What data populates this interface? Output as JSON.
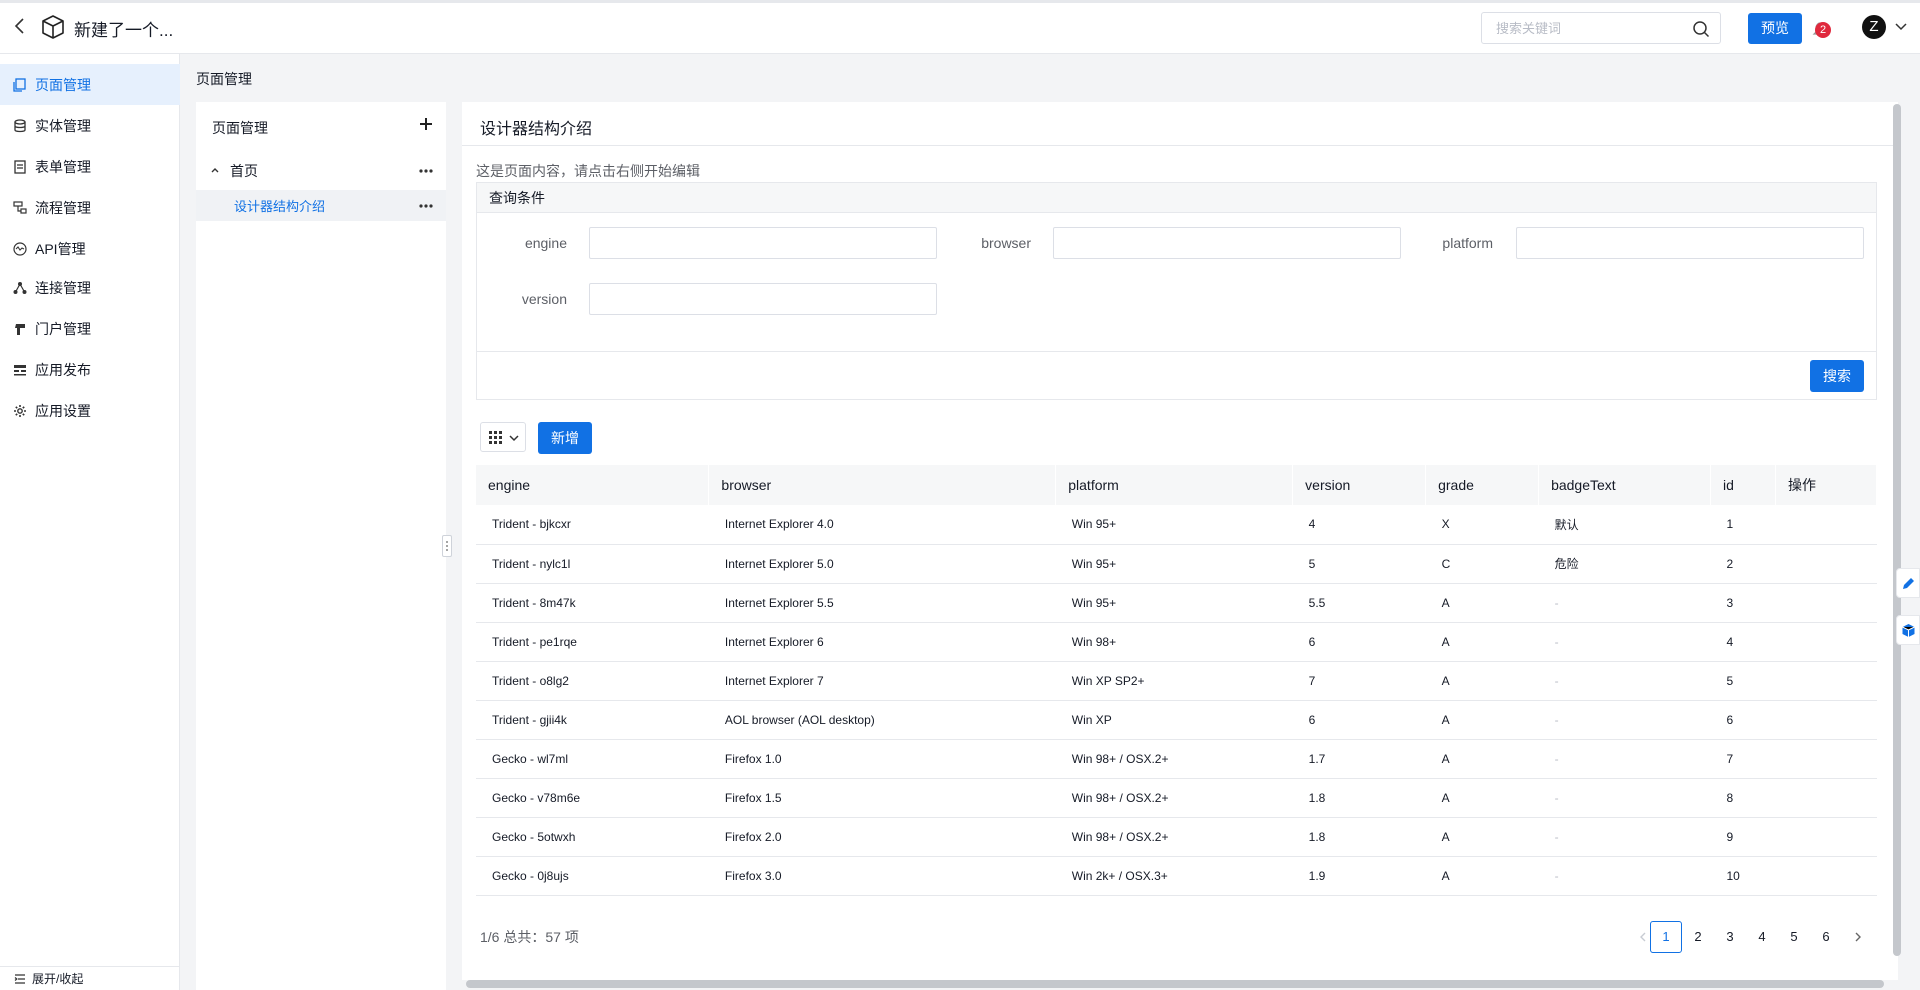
{
  "header": {
    "app_title": "新建了一个...",
    "search_placeholder": "搜索关键词",
    "preview_label": "预览",
    "notification_count": "2",
    "avatar_initial": "Z"
  },
  "sidebar": {
    "items": [
      {
        "label": "页面管理",
        "icon": "page-icon",
        "active": true
      },
      {
        "label": "实体管理",
        "icon": "database-icon"
      },
      {
        "label": "表单管理",
        "icon": "form-icon"
      },
      {
        "label": "流程管理",
        "icon": "flow-icon"
      },
      {
        "label": "API管理",
        "icon": "api-icon"
      },
      {
        "label": "连接管理",
        "icon": "connection-icon"
      },
      {
        "label": "门户管理",
        "icon": "portal-icon"
      },
      {
        "label": "应用发布",
        "icon": "publish-icon"
      },
      {
        "label": "应用设置",
        "icon": "gear-icon"
      }
    ],
    "collapse_label": "展开/收起"
  },
  "breadcrumb": "页面管理",
  "tree": {
    "title": "页面管理",
    "nodes": [
      {
        "label": "首页"
      },
      {
        "label": "设计器结构介绍",
        "selected": true
      }
    ]
  },
  "main": {
    "title": "设计器结构介绍",
    "intro": "这是页面内容，请点击右侧开始编辑",
    "query": {
      "title": "查询条件",
      "fields": [
        {
          "label": "engine",
          "value": ""
        },
        {
          "label": "browser",
          "value": ""
        },
        {
          "label": "platform",
          "value": ""
        },
        {
          "label": "version",
          "value": ""
        }
      ],
      "search_label": "搜索"
    },
    "add_label": "新增",
    "table": {
      "columns": [
        "engine",
        "browser",
        "platform",
        "version",
        "grade",
        "badgeText",
        "id",
        "操作"
      ],
      "rows": [
        [
          "Trident - bjkcxr",
          "Internet Explorer 4.0",
          "Win 95+",
          "4",
          "X",
          "默认",
          "1"
        ],
        [
          "Trident - nylc1l",
          "Internet Explorer 5.0",
          "Win 95+",
          "5",
          "C",
          "危险",
          "2"
        ],
        [
          "Trident - 8m47k",
          "Internet Explorer 5.5",
          "Win 95+",
          "5.5",
          "A",
          "-",
          "3"
        ],
        [
          "Trident - pe1rqe",
          "Internet Explorer 6",
          "Win 98+",
          "6",
          "A",
          "-",
          "4"
        ],
        [
          "Trident - o8lg2",
          "Internet Explorer 7",
          "Win XP SP2+",
          "7",
          "A",
          "-",
          "5"
        ],
        [
          "Trident - gjii4k",
          "AOL browser (AOL desktop)",
          "Win XP",
          "6",
          "A",
          "-",
          "6"
        ],
        [
          "Gecko - wl7ml",
          "Firefox 1.0",
          "Win 98+ / OSX.2+",
          "1.7",
          "A",
          "-",
          "7"
        ],
        [
          "Gecko - v78m6e",
          "Firefox 1.5",
          "Win 98+ / OSX.2+",
          "1.8",
          "A",
          "-",
          "8"
        ],
        [
          "Gecko - 5otwxh",
          "Firefox 2.0",
          "Win 98+ / OSX.2+",
          "1.8",
          "A",
          "-",
          "9"
        ],
        [
          "Gecko - 0j8ujs",
          "Firefox 3.0",
          "Win 2k+ / OSX.3+",
          "1.9",
          "A",
          "-",
          "10"
        ]
      ]
    },
    "pager": {
      "info": "1/6 总共：57 项",
      "pages": [
        "1",
        "2",
        "3",
        "4",
        "5",
        "6"
      ],
      "current": "1"
    }
  }
}
